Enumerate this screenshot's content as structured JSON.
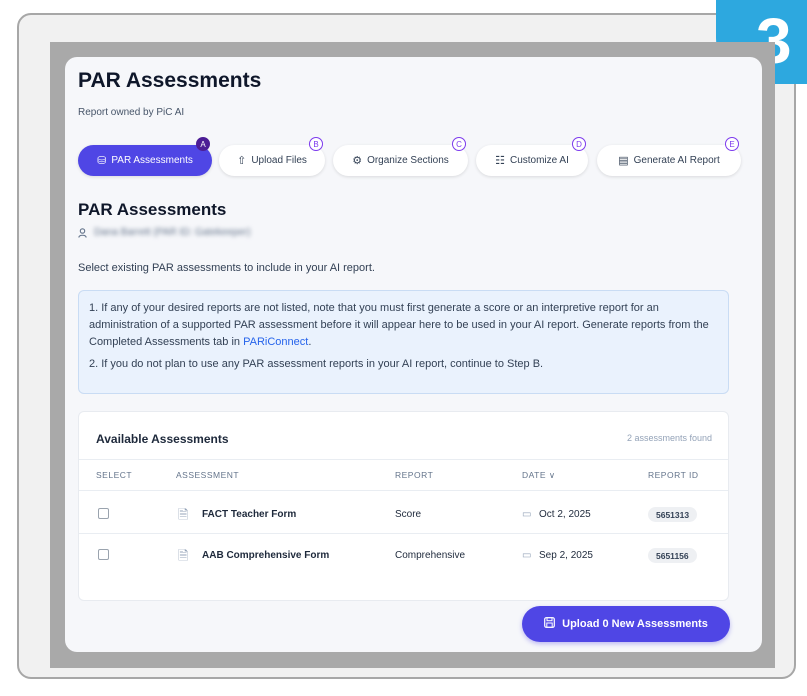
{
  "step_badge": "3",
  "header": {
    "title": "PAR Assessments",
    "owner": "Report owned by PiC AI"
  },
  "steps": [
    {
      "label": "PAR Assessments",
      "letter": "A",
      "icon": "database-icon",
      "glyph": "⛁",
      "active": true
    },
    {
      "label": "Upload Files",
      "letter": "B",
      "icon": "upload-icon",
      "glyph": "⇧",
      "active": false
    },
    {
      "label": "Organize Sections",
      "letter": "C",
      "icon": "gear-icon",
      "glyph": "⚙",
      "active": false
    },
    {
      "label": "Customize AI",
      "letter": "D",
      "icon": "sliders-icon",
      "glyph": "☷",
      "active": false
    },
    {
      "label": "Generate AI Report",
      "letter": "E",
      "icon": "report-icon",
      "glyph": "▤",
      "active": false
    }
  ],
  "section": {
    "title": "PAR Assessments",
    "user_icon": "user-icon",
    "user": "Dana Barrett (PAR ID: Gatekeeper)",
    "instruction": "Select existing PAR assessments to include in your AI report."
  },
  "info": {
    "line1_before": "1. If any of your desired reports are not listed, note that you must first generate a score or an interpretive report for an administration of a supported PAR assessment before it will appear here to be used in your AI report. Generate reports from the Completed Assessments tab in",
    "link": "PARiConnect",
    "line1_after": ".",
    "line2": "2. If you do not plan to use any PAR assessment reports in your AI report, continue to Step B."
  },
  "table": {
    "title": "Available Assessments",
    "count": "2 assessments found",
    "columns": [
      "SELECT",
      "ASSESSMENT",
      "REPORT",
      "DATE ∨",
      "REPORT ID"
    ],
    "rows": [
      {
        "assessment": "FACT Teacher Form",
        "report": "Score",
        "date": "Oct 2, 2025",
        "report_id": "5651313"
      },
      {
        "assessment": "AAB Comprehensive Form",
        "report": "Comprehensive",
        "date": "Sep 2, 2025",
        "report_id": "5651156"
      }
    ]
  },
  "upload_button": {
    "label": "Upload 0 New Assessments",
    "icon": "save-icon"
  },
  "colors": {
    "accent": "#4f46e5",
    "badge": "#2da8df",
    "info_bg": "#eaf2fd"
  }
}
